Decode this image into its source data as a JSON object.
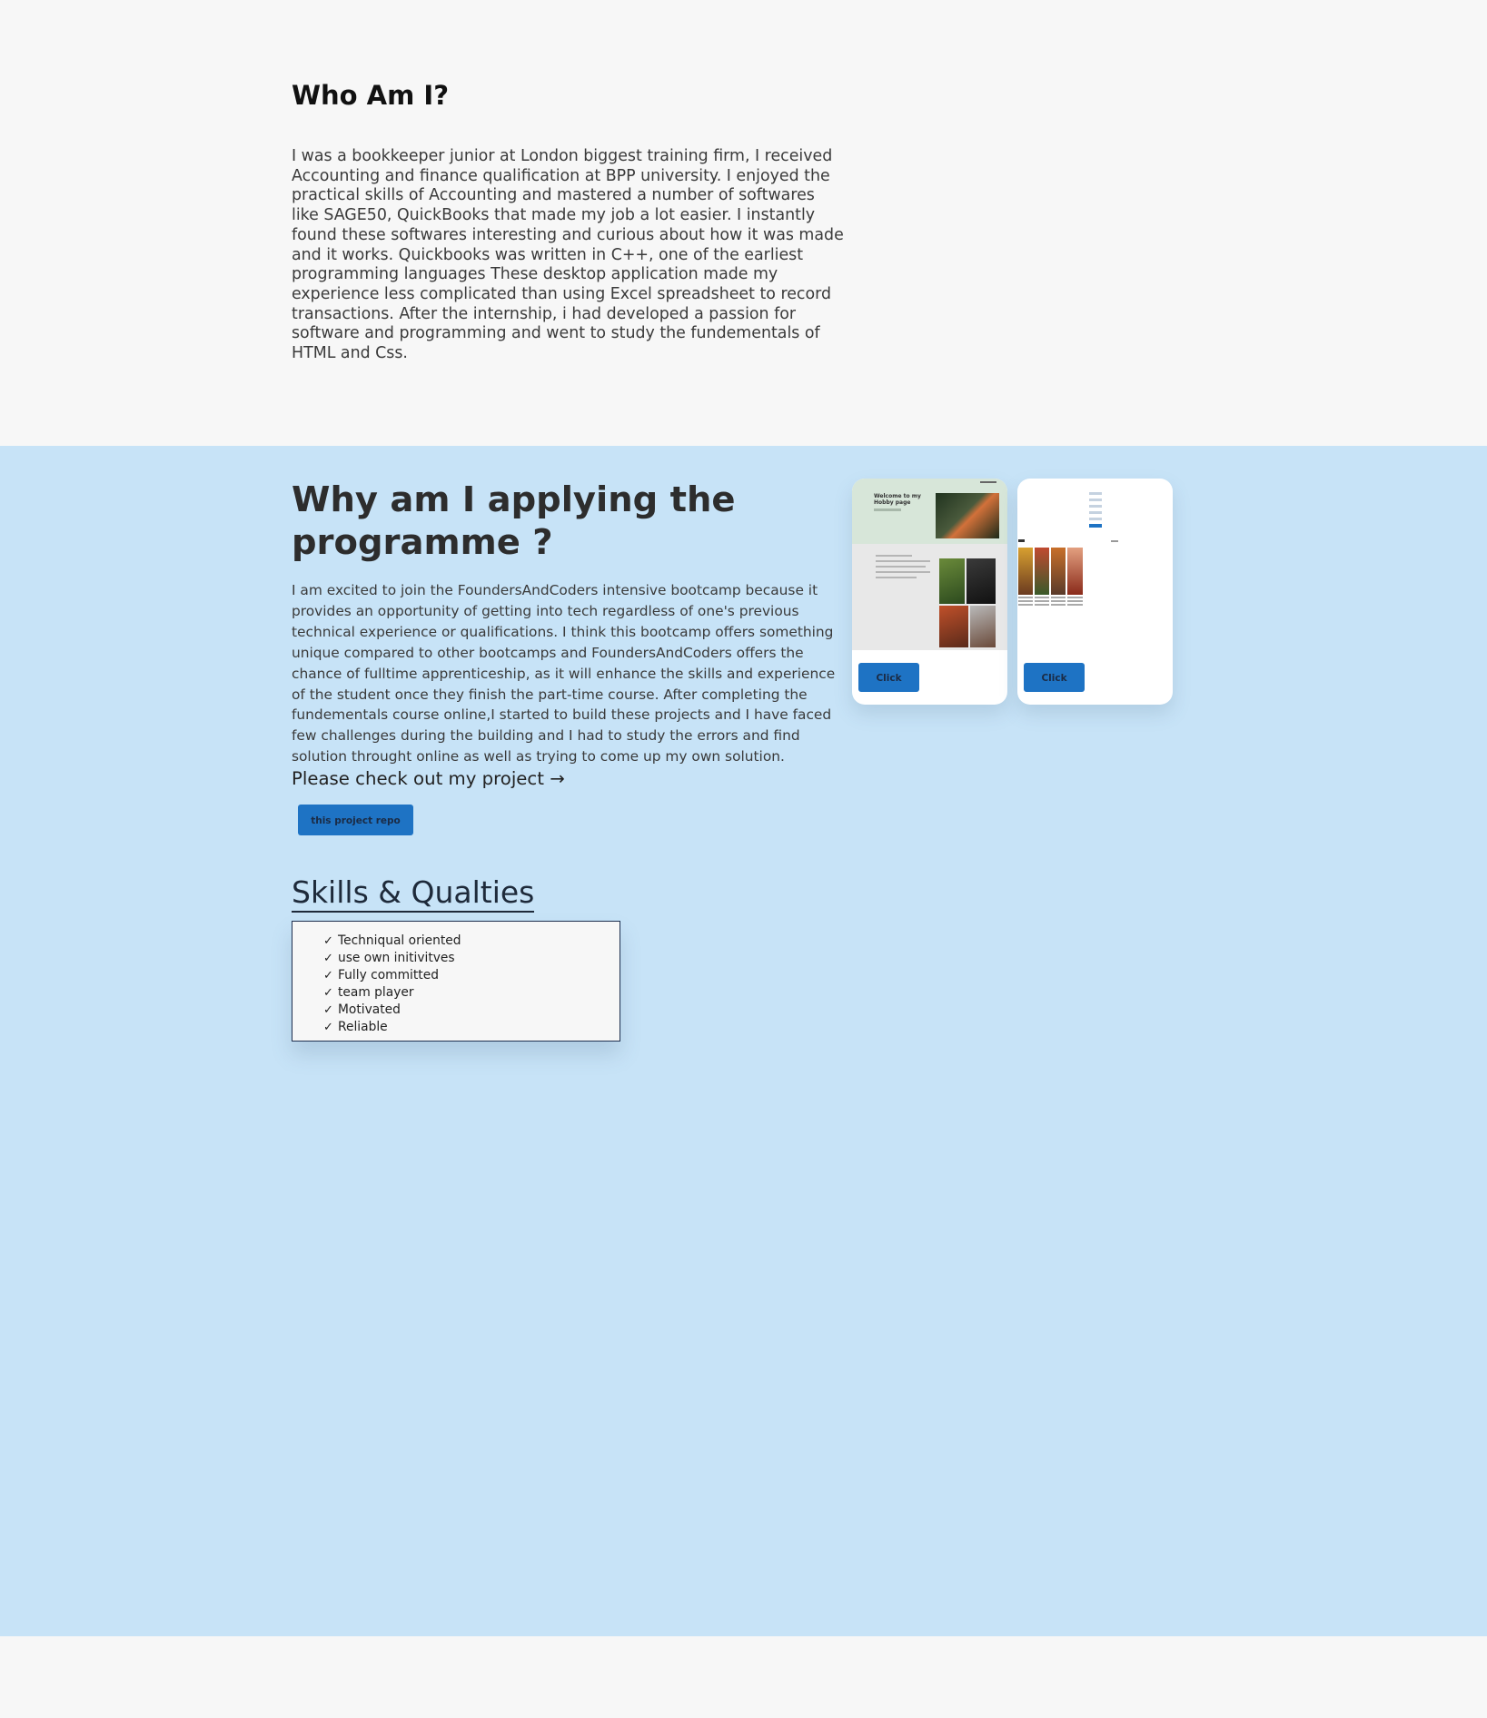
{
  "about": {
    "heading": "Who Am I?",
    "paragraph": "I was a bookkeeper junior at London biggest training firm, I received Accounting and finance qualification at BPP university. I enjoyed the practical skills of Accounting and mastered a number of softwares like SAGE50, QuickBooks that made my job a lot easier. I instantly found these softwares interesting and curious about how it was made and it works. Quickbooks was written in C++, one of the earliest programming languages These desktop application made my experience less complicated than using Excel spreadsheet to record transactions. After the internship, i had developed a passion for software and programming and went to study the fundementals of HTML and Css."
  },
  "why": {
    "heading": "Why am I applying the programme ?",
    "paragraph": "I am excited to join the FoundersAndCoders intensive bootcamp because it provides an opportunity of getting into tech regardless of one's previous technical experience or qualifications. I think this bootcamp offers something unique compared to other bootcamps and FoundersAndCoders offers the chance of fulltime apprenticeship, as it will enhance the skills and experience of the student once they finish the part-time course. After completing the fundementals course online,I started to build these projects and I have faced few challenges during the building and I had to study the errors and find solution throught online as well as trying to come up my own solution.",
    "check_out": "Please check out my project →",
    "repo_button": "this project repo"
  },
  "projects": [
    {
      "button": "Click",
      "thumbnail_title": "Welcome to my Hobby page"
    },
    {
      "button": "Click"
    }
  ],
  "skills": {
    "title": "Skills & Qualties",
    "tick": "✓",
    "items": [
      "Techniqual oriented",
      "use own initivitves",
      "Fully committed",
      "team player",
      "Motivated",
      "Reliable"
    ]
  },
  "colors": {
    "section_blue": "#c7e3f7",
    "page_bg": "#f7f7f7",
    "button_blue": "#1e73c4"
  }
}
